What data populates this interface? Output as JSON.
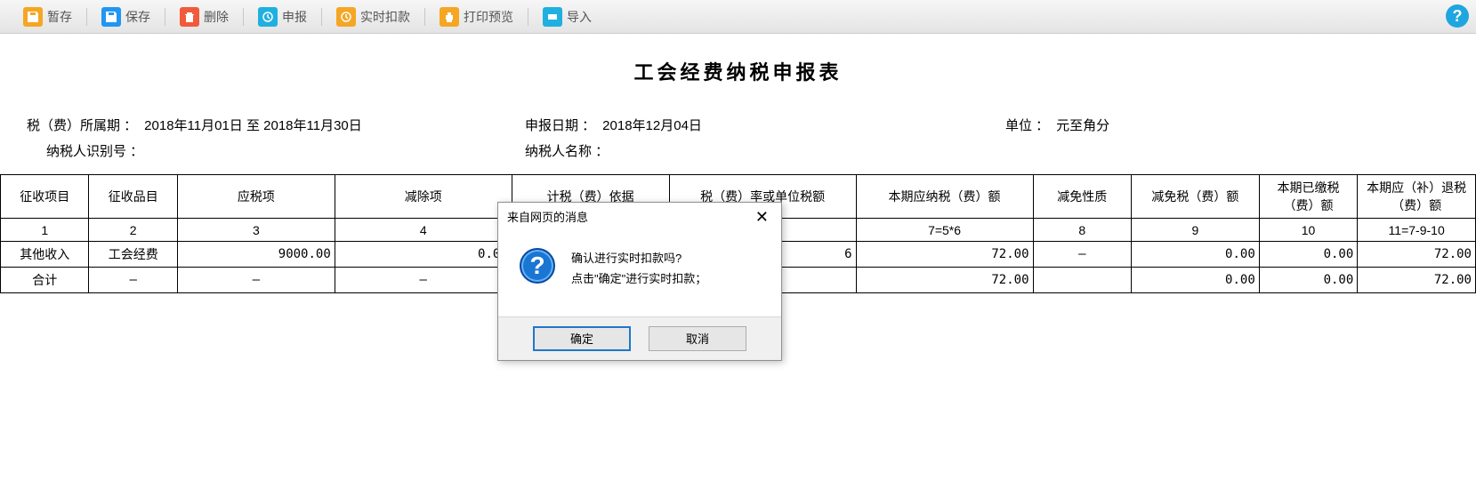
{
  "toolbar": {
    "temp_save": "暂存",
    "save": "保存",
    "delete": "删除",
    "declare": "申报",
    "realtime_deduct": "实时扣款",
    "print_preview": "打印预览",
    "import": "导入"
  },
  "title": "工会经费纳税申报表",
  "info": {
    "period_label": "税（费）所属期 ：",
    "period_value": "2018年11月01日 至 2018年11月30日",
    "declare_date_label": "申报日期 ：",
    "declare_date_value": "2018年12月04日",
    "unit_label": "单位 ：",
    "unit_value": "元至角分",
    "taxpayer_id_label": "纳税人识别号 ：",
    "taxpayer_id_value": "",
    "taxpayer_name_label": "纳税人名称 ：",
    "taxpayer_name_value": ""
  },
  "headers": {
    "h1": "征收项目",
    "h2": "征收品目",
    "h3": "应税项",
    "h4": "减除项",
    "h5": "计税（费）依据",
    "h6": "税（费）率或单位税额",
    "h7": "本期应纳税（费）额",
    "h8": "减免性质",
    "h9": "减免税（费）额",
    "h10": "本期已缴税（费）额",
    "h11": "本期应（补）退税（费）额"
  },
  "header_nums": {
    "n1": "1",
    "n2": "2",
    "n3": "3",
    "n4": "4",
    "n7": "7=5*6",
    "n8": "8",
    "n9": "9",
    "n10": "10",
    "n11": "11=7-9-10"
  },
  "rows": [
    {
      "c1": "其他收入",
      "c2": "工会经费",
      "c3": "9000.00",
      "c4": "0.00",
      "c6_suffix": "6",
      "c7": "72.00",
      "c8": "—",
      "c9": "0.00",
      "c10": "0.00",
      "c11": "72.00"
    }
  ],
  "total": {
    "label": "合计",
    "c2": "—",
    "c3": "—",
    "c4": "—",
    "c7": "72.00",
    "c9": "0.00",
    "c10": "0.00",
    "c11": "72.00"
  },
  "dialog": {
    "title": "来自网页的消息",
    "line1": "确认进行实时扣款吗?",
    "line2": "点击\"确定\"进行实时扣款；",
    "ok": "确定",
    "cancel": "取消"
  }
}
